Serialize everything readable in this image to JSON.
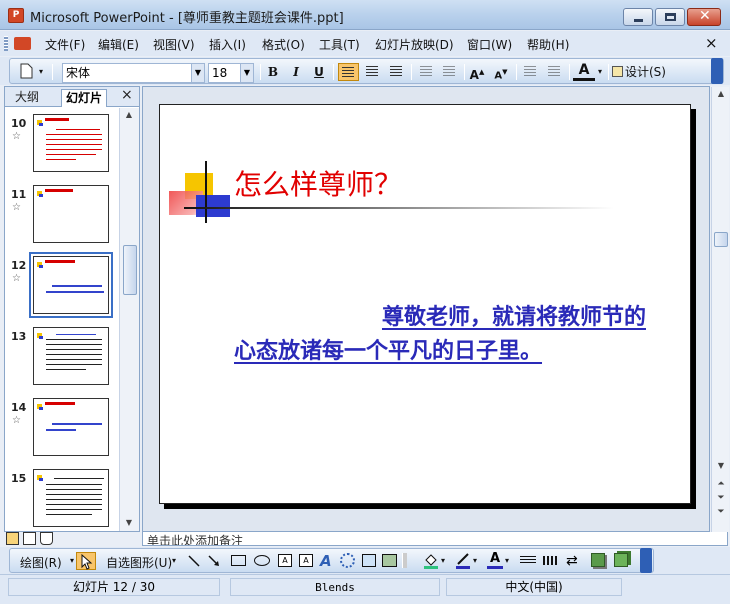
{
  "window": {
    "title": "Microsoft PowerPoint - [尊师重教主题班会课件.ppt]",
    "app_icon": "powerpoint-icon"
  },
  "menu": {
    "items": [
      "文件(F)",
      "编辑(E)",
      "视图(V)",
      "插入(I)",
      "格式(O)",
      "工具(T)",
      "幻灯片放映(D)",
      "窗口(W)",
      "帮助(H)"
    ],
    "close_glyph": "×"
  },
  "format_toolbar": {
    "font_name": "宋体",
    "font_size": "18",
    "bold": "B",
    "italic": "I",
    "underline": "U",
    "design_label": "设计(S)",
    "font_color_glyph": "A"
  },
  "panel": {
    "tab_outline": "大纲",
    "tab_slides": "幻灯片",
    "close_glyph": "×",
    "thumbnails": [
      {
        "number": "10"
      },
      {
        "number": "11"
      },
      {
        "number": "12"
      },
      {
        "number": "13"
      },
      {
        "number": "14"
      },
      {
        "number": "15"
      }
    ],
    "selected_slide": "12"
  },
  "slide": {
    "title": "怎么样尊师？",
    "body_line1": "尊敬老师，就请将教师节的",
    "body_line2": "心态放诸每一个平凡的日子里。",
    "title_color": "#e10000",
    "body_color": "#2a2ab8"
  },
  "notes": {
    "placeholder": "单击此处添加备注"
  },
  "drawing_toolbar": {
    "draw_label": "绘图(R)",
    "autoshapes_label": "自选图形(U)"
  },
  "status": {
    "slide_position": "幻灯片 12 / 30",
    "design_name": "Blends",
    "language": "中文(中国)"
  }
}
